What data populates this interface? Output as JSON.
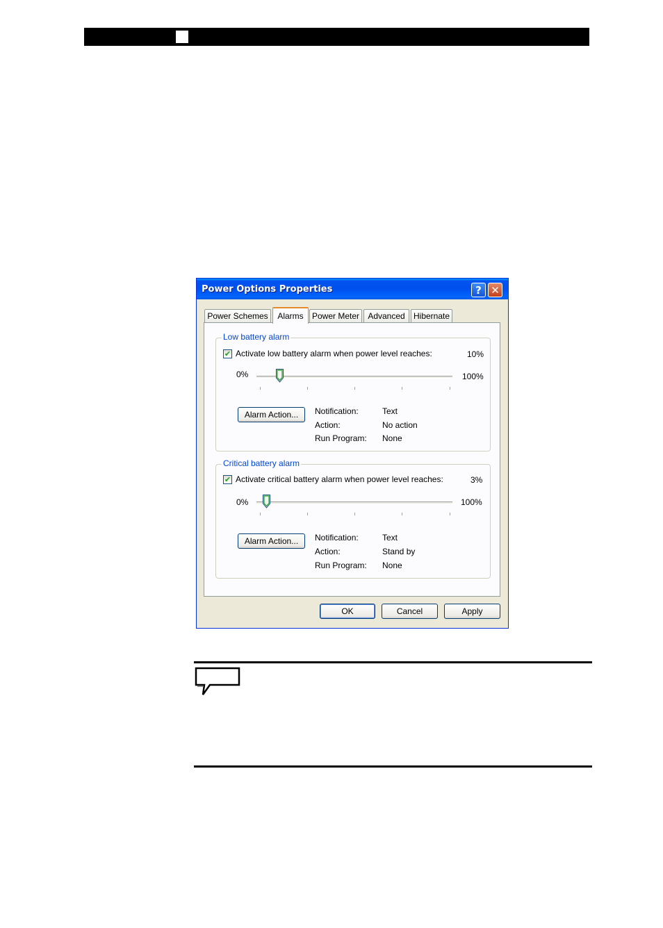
{
  "dialog": {
    "title": "Power Options Properties",
    "help_glyph": "?",
    "close_glyph": "✕",
    "tabs": [
      {
        "label": "Power Schemes",
        "active": false
      },
      {
        "label": "Alarms",
        "active": true
      },
      {
        "label": "Power Meter",
        "active": false
      },
      {
        "label": "Advanced",
        "active": false
      },
      {
        "label": "Hibernate",
        "active": false
      }
    ],
    "low": {
      "group_title": "Low battery alarm",
      "checkbox_label": "Activate low battery alarm when power level reaches:",
      "checked": true,
      "value_text": "10%",
      "level_percent": 10,
      "min_label": "0%",
      "max_label": "100%",
      "action_button": "Alarm Action...",
      "notification_label": "Notification:",
      "notification_value": "Text",
      "action_label": "Action:",
      "action_value": "No action",
      "run_label": "Run Program:",
      "run_value": "None"
    },
    "critical": {
      "group_title": "Critical battery alarm",
      "checkbox_label": "Activate critical battery alarm when power level reaches:",
      "checked": true,
      "value_text": "3%",
      "level_percent": 3,
      "min_label": "0%",
      "max_label": "100%",
      "action_button": "Alarm Action...",
      "notification_label": "Notification:",
      "notification_value": "Text",
      "action_label": "Action:",
      "action_value": "Stand by",
      "run_label": "Run Program:",
      "run_value": "None"
    },
    "buttons": {
      "ok": "OK",
      "cancel": "Cancel",
      "apply": "Apply"
    }
  },
  "icons": {
    "header_box": "white-square-icon",
    "note": "speech-bubble-icon",
    "checkmark": "✔"
  },
  "colors": {
    "titlebar": "#0054e3",
    "group_title": "#0046d5",
    "dialog_bg": "#ece9d8",
    "active_tab_accent": "#e68b2c"
  }
}
